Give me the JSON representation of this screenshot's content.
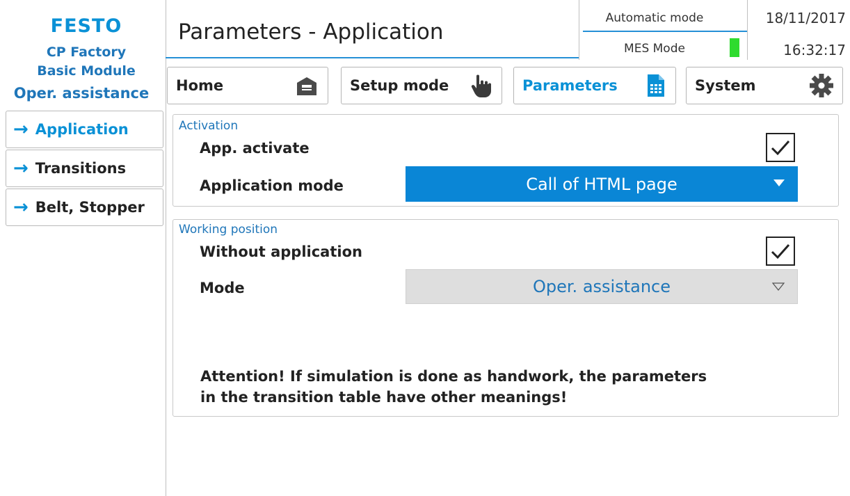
{
  "brand": {
    "logo": "FESTO",
    "line1": "CP Factory",
    "line2": "Basic Module",
    "section_title": "Oper. assistance"
  },
  "sidebar": {
    "items": [
      {
        "label": "Application",
        "active": true
      },
      {
        "label": "Transitions",
        "active": false
      },
      {
        "label": "Belt, Stopper",
        "active": false
      }
    ]
  },
  "header": {
    "title": "Parameters - Application",
    "automatic_mode": "Automatic mode",
    "mes_mode": "MES Mode",
    "mes_indicator_color": "#2edb2e",
    "date": "18/11/2017",
    "time": "16:32:17"
  },
  "tabs": [
    {
      "label": "Home",
      "icon": "home-icon"
    },
    {
      "label": "Setup mode",
      "icon": "hand-pointer-icon"
    },
    {
      "label": "Parameters",
      "icon": "document-icon",
      "active": true
    },
    {
      "label": "System",
      "icon": "gear-icon"
    }
  ],
  "activation": {
    "title": "Activation",
    "app_activate_label": "App. activate",
    "app_activate_checked": true,
    "application_mode_label": "Application mode",
    "application_mode_value": "Call of HTML page"
  },
  "working_position": {
    "title": "Working position",
    "without_application_label": "Without application",
    "without_application_checked": true,
    "mode_label": "Mode",
    "mode_value": "Oper. assistance"
  },
  "attention": {
    "line1": "Attention! If simulation is done as handwork, the parameters",
    "line2": "in the transition table have other meanings!"
  },
  "colors": {
    "accent": "#0a91d6",
    "select_blue": "#0a86d6"
  }
}
